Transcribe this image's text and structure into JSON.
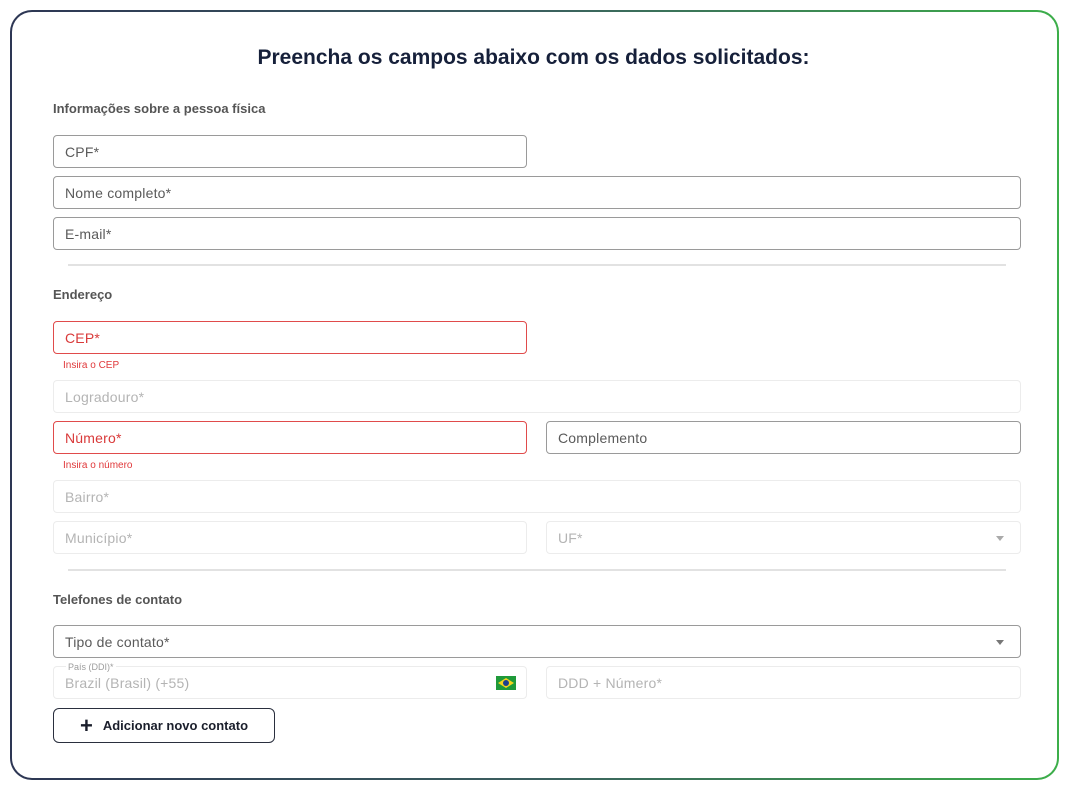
{
  "title": "Preencha os campos abaixo com os dados solicitados:",
  "sections": {
    "person": "Informações sobre a pessoa física",
    "address": "Endereço",
    "phones": "Telefones de contato"
  },
  "fields": {
    "cpf": "CPF*",
    "nome": "Nome completo*",
    "email": "E-mail*",
    "cep": "CEP*",
    "cep_error": "Insira o CEP",
    "logradouro": "Logradouro*",
    "numero": "Número*",
    "numero_error": "Insira o número",
    "complemento": "Complemento",
    "bairro": "Bairro*",
    "municipio": "Município*",
    "uf": "UF*",
    "tipo_contato": "Tipo de contato*",
    "pais_label": "País (DDI)*",
    "pais_value": "Brazil (Brasil) (+55)",
    "ddd_numero": "DDD + Número*"
  },
  "add_contact_button": "Adicionar novo contato",
  "colors": {
    "error": "#e04b4b",
    "title": "#16203a",
    "border_gradient_start": "#2d3654",
    "border_gradient_end": "#3cae4a"
  },
  "icons": {
    "dropdown": "chevron-down-icon",
    "flag": "brazil-flag-icon",
    "add": "plus-icon"
  }
}
